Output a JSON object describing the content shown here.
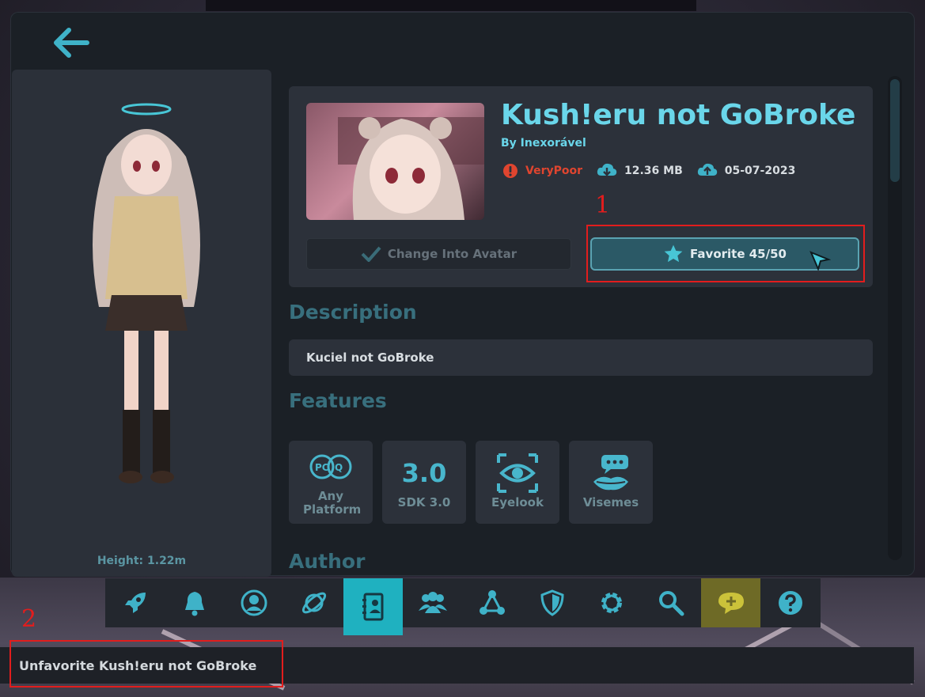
{
  "avatar": {
    "title": "Kush!eru not GoBroke",
    "author": "By Inexorável",
    "performance": "VeryPoor",
    "size": "12.36 MB",
    "date": "05-07-2023",
    "height": "Height: 1.22m"
  },
  "actions": {
    "change_label": "Change Into Avatar",
    "favorite_label": "Favorite 45/50"
  },
  "description": {
    "heading": "Description",
    "text": "Kuciel not GoBroke"
  },
  "features": {
    "heading": "Features",
    "items": [
      {
        "label": "Any Platform",
        "icon": "pc-quest-icon"
      },
      {
        "label": "SDK 3.0",
        "icon": "sdk-icon",
        "badge": "3.0"
      },
      {
        "label": "Eyelook",
        "icon": "eye-icon"
      },
      {
        "label": "Visemes",
        "icon": "visemes-icon"
      }
    ]
  },
  "author_heading": "Author",
  "nav": [
    {
      "name": "nav-launch",
      "icon": "rocket-icon"
    },
    {
      "name": "nav-notifications",
      "icon": "bell-icon"
    },
    {
      "name": "nav-profile",
      "icon": "user-icon"
    },
    {
      "name": "nav-worlds",
      "icon": "planet-icon"
    },
    {
      "name": "nav-avatars",
      "icon": "avatar-card-icon",
      "active": true
    },
    {
      "name": "nav-social",
      "icon": "people-icon"
    },
    {
      "name": "nav-groups",
      "icon": "network-icon"
    },
    {
      "name": "nav-safety",
      "icon": "shield-icon"
    },
    {
      "name": "nav-settings",
      "icon": "gear-icon"
    },
    {
      "name": "nav-search",
      "icon": "search-icon"
    },
    {
      "name": "nav-chat",
      "icon": "chat-add-icon"
    },
    {
      "name": "nav-help",
      "icon": "help-icon"
    }
  ],
  "status_message": "Unfavorite Kush!eru not GoBroke",
  "annotations": {
    "one": "1",
    "two": "2"
  },
  "colors": {
    "accent": "#6ad6ea",
    "perf_bad": "#e0452f",
    "highlight": "#e21d1d"
  }
}
